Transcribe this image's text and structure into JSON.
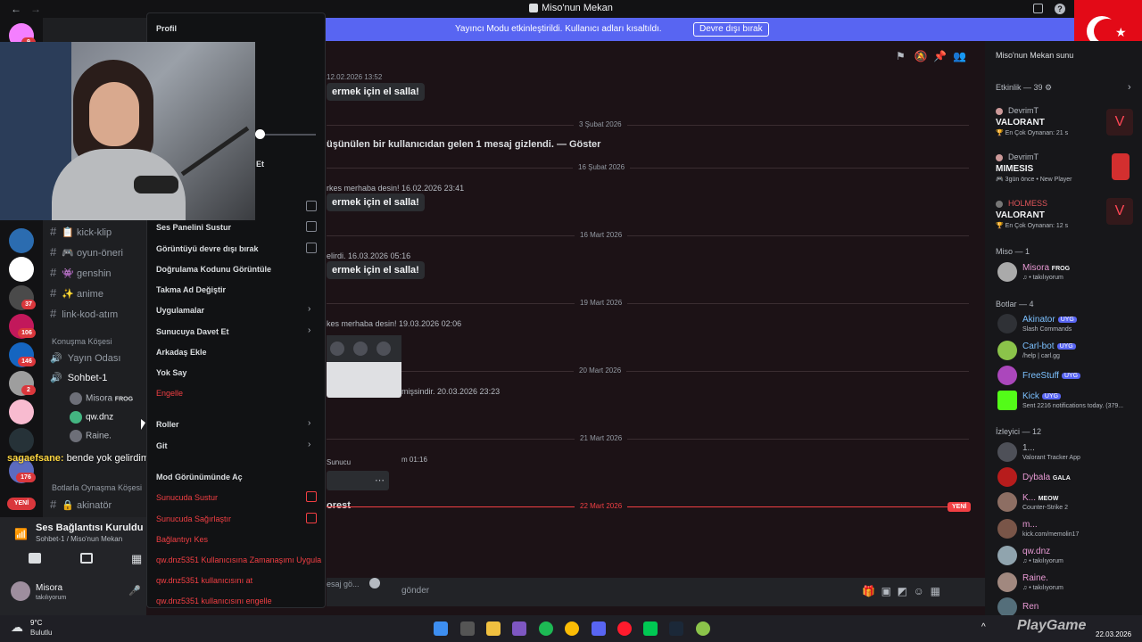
{
  "window": {
    "title": "Miso'nun Mekan",
    "title_icon": "server-icon"
  },
  "notice": {
    "text": "Yayıncı Modu etkinleştirildi. Kullanıcı adları kısaltıldı.",
    "button": "Devre dışı bırak",
    "color": "#5865f2"
  },
  "rail": {
    "badges": [
      "9",
      "37",
      "106",
      "146",
      "2",
      "176"
    ],
    "new_label": "YENİ"
  },
  "channels": {
    "items": [
      {
        "hash": "#",
        "icon": "📋",
        "label": "kick-klip"
      },
      {
        "hash": "#",
        "icon": "🎮",
        "label": "oyun-öneri"
      },
      {
        "hash": "#",
        "icon": "👾",
        "label": "genshin"
      },
      {
        "hash": "#",
        "icon": "✨",
        "label": "anime"
      },
      {
        "hash": "#",
        "icon": "",
        "label": "link-kod-atım"
      }
    ],
    "cat1": "Konuşma Köşesi",
    "voice1": "Yayın Odası",
    "voice2": "Sohbet-1",
    "voice_users": [
      "Misora",
      "qw.dnz",
      "Raine."
    ],
    "voice_user_tag": "FROG",
    "chat_overlay_user": "sagaefsane:",
    "chat_overlay_text": "bende yok gelirdimde :D",
    "cat2": "Botlarla Oynaşma Köşesi",
    "bot_channel": "akinatör"
  },
  "voicepanel": {
    "status": "Ses Bağlantısı Kuruldu",
    "sub": "Sohbet-1 / Miso'nun Mekan",
    "user": "Misora",
    "user_status": "takılıyorum"
  },
  "chat": {
    "msgs": [
      {
        "ts": "12.02.2026 13:52",
        "text": "ermek için el salla!"
      },
      {
        "text": "üşünülen bir kullanıcıdan gelen 1 mesaj gizlendi. — Göster"
      },
      {
        "meta": "rkes merhaba desin! 16.02.2026 23:41",
        "text": "ermek için el salla!"
      },
      {
        "meta": "elirdi. 16.03.2026 05:16",
        "text": "ermek için el salla!"
      },
      {
        "meta": "kes merhaba desin! 19.03.2026 02:06"
      },
      {
        "meta": "mişsindir. 20.03.2026 23:23"
      },
      {
        "meta": "Sunucu"
      },
      {
        "meta": "m 01:16"
      },
      {
        "text": "orest"
      }
    ],
    "dates": [
      "3 Şubat 2026",
      "16 Şubat 2026",
      "16 Mart 2026",
      "19 Mart 2026",
      "20 Mart 2026",
      "21 Mart 2026",
      "22 Mart 2026"
    ],
    "new_label": "YENİ",
    "composer_placeholder": "gönder",
    "composer_left": "esaj gö..."
  },
  "context_menu": {
    "top": [
      "Profil"
    ],
    "items_checkbox": [
      "Ses Panelini Sustur",
      "Görüntüyü devre dışı bırak"
    ],
    "items": [
      "Doğrulama Kodunu Görüntüle",
      "Takma Ad Değiştir"
    ],
    "sub1": "Uygulamalar",
    "sub2": "Sunucuya Davet Et",
    "items2": [
      "Arkadaş Ekle",
      "Yok Say"
    ],
    "block": "Engelle",
    "roles": "Roller",
    "go": "Git",
    "mod": "Mod Görünümünde Aç",
    "mute": "Sunucuda Sustur",
    "deafen": "Sunucuda Sağırlaştır",
    "disconnect": "Bağlantıyı Kes",
    "timeout": "qw.dnz5351 Kullanıcısına Zamanaşımı Uygula",
    "kick": "qw.dnz5351 kullanıcısını at",
    "ban": "qw.dnz5351 kullanıcısını engelle",
    "fragment": "Et"
  },
  "members": {
    "header": "Miso'nun Mekan sunu",
    "activity": "Etkinlik — 39",
    "acts": [
      {
        "user": "DevrimT",
        "game": "VALORANT",
        "sub": "En Çok Oynanan: 21 s"
      },
      {
        "user": "DevrimT",
        "game": "MIMESIS",
        "sub": "3gün önce  •  New Player"
      },
      {
        "user": "HOLMESS",
        "game": "VALORANT",
        "sub": "En Çok Oynanan: 12 s"
      }
    ],
    "sec_miso": "Miso — 1",
    "miso": {
      "name": "Misora",
      "tag": "FROG",
      "sub": "takılıyorum"
    },
    "sec_bots": "Botlar — 4",
    "bots": [
      {
        "name": "Akinator",
        "tag": "UYG",
        "sub": "Slash Commands"
      },
      {
        "name": "Carl-bot",
        "tag": "UYG",
        "sub": "/help | carl.gg"
      },
      {
        "name": "FreeStuff",
        "tag": "UYG",
        "sub": ""
      },
      {
        "name": "Kick",
        "tag": "UYG",
        "sub": "Sent 2216 notifications today. (379..."
      }
    ],
    "sec_viewers": "İzleyici — 12",
    "viewers": [
      {
        "name": "1...",
        "sub": "Valorant Tracker App"
      },
      {
        "name": "Dybala",
        "tag": "GALA",
        "sub": ""
      },
      {
        "name": "K...",
        "tag": "MEOW",
        "sub": "Counter-Strike 2"
      },
      {
        "name": "m...",
        "sub": "kick.com/memolin17"
      },
      {
        "name": "qw.dnz",
        "sub": "takılıyorum"
      },
      {
        "name": "Raine.",
        "sub": "takılıyorum"
      },
      {
        "name": "Ren",
        "sub": ""
      }
    ]
  },
  "taskbar": {
    "weather_temp": "9°C",
    "weather_desc": "Bulutlu",
    "date": "22.03.2026",
    "watermark": "PlayGame"
  }
}
